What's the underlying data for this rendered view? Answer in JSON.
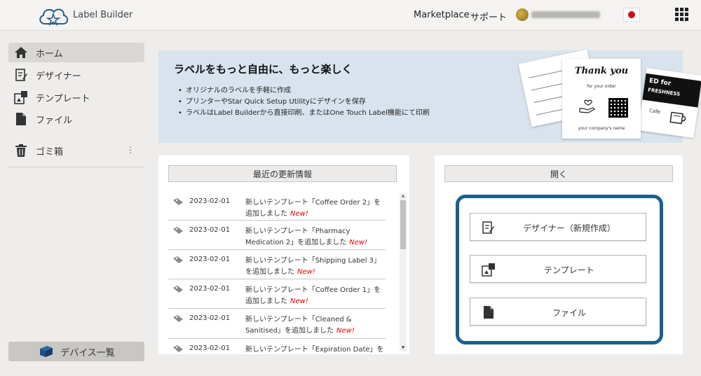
{
  "header": {
    "brand": "Label Builder",
    "nav": {
      "marketplace": "Marketplace",
      "support": "サポート"
    },
    "icons": {
      "logo": "cloud-star-logo-icon",
      "flag": "japan-flag-icon",
      "apps": "apps-grid-icon"
    }
  },
  "sidebar": {
    "items": [
      {
        "label": "ホーム",
        "icon": "home-icon",
        "active": true
      },
      {
        "label": "デザイナー",
        "icon": "designer-icon"
      },
      {
        "label": "テンプレート",
        "icon": "template-icon"
      },
      {
        "label": "ファイル",
        "icon": "file-icon"
      },
      {
        "label": "ゴミ箱",
        "icon": "trash-icon"
      }
    ],
    "kebab": "⋮",
    "device_button": "デバイス一覧"
  },
  "banner": {
    "title": "ラベルをもっと自由に、もっと楽しく",
    "bullets": [
      "オリジナルのラベルを手軽に作成",
      "プリンターやStar Quick Setup Utilityにデザインを保存",
      "ラベルはLabel Builderから直接印刷、またはOne Touch Label機能にて印刷"
    ],
    "card_thank_you": "Thank you",
    "card_for_your_order": "for your order",
    "card_company_name": "your company's name",
    "card_fresh_line1": "ED for",
    "card_fresh_line2": "FRESHNESS",
    "card_cafe": "Cafe"
  },
  "news": {
    "header": "最近の更新情報",
    "new_badge": "New!",
    "items": [
      {
        "date": "2023-02-01",
        "text": "新しいテンプレート「Coffee Order 2」を追加しました"
      },
      {
        "date": "2023-02-01",
        "text": "新しいテンプレート「Pharmacy Medication 2」を追加しました"
      },
      {
        "date": "2023-02-01",
        "text": "新しいテンプレート「Shipping Label 3」を追加しました"
      },
      {
        "date": "2023-02-01",
        "text": "新しいテンプレート「Coffee Order 1」を追加しました"
      },
      {
        "date": "2023-02-01",
        "text": "新しいテンプレート「Cleaned & Sanitised」を追加しました"
      },
      {
        "date": "2023-02-01",
        "text": "新しいテンプレート「Expiration Date」を"
      }
    ]
  },
  "open": {
    "header": "開く",
    "buttons": [
      {
        "label": "デザイナー（新規作成）",
        "icon": "designer-icon"
      },
      {
        "label": "テンプレート",
        "icon": "template-icon"
      },
      {
        "label": "ファイル",
        "icon": "file-icon"
      }
    ],
    "highlight_color": "#1c5f8e"
  }
}
